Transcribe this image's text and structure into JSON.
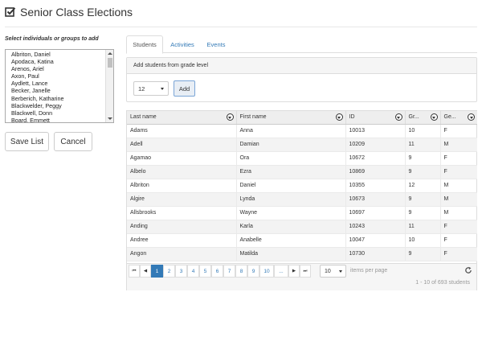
{
  "header": {
    "title": "Senior Class Elections",
    "icon": "checkbox-icon"
  },
  "left": {
    "label": "Select individuals or groups to add",
    "names": [
      "Albriton, Daniel",
      "Apodaca, Katina",
      "Arenos, Ariel",
      "Axon, Paul",
      "Aydlett, Lance",
      "Becker, Janelle",
      "Berberich, Katharine",
      "Blackwelder, Peggy",
      "Blackwell, Donn",
      "Board, Emmett"
    ],
    "save_label": "Save List",
    "cancel_label": "Cancel"
  },
  "tabs": [
    {
      "label": "Students"
    },
    {
      "label": "Activities"
    },
    {
      "label": "Events"
    }
  ],
  "grade_panel": {
    "header": "Add students from grade level",
    "selected_grade": "12",
    "add_label": "Add"
  },
  "grid": {
    "columns": [
      "Last name",
      "First name",
      "ID",
      "Gr...",
      "Ge..."
    ],
    "rows": [
      [
        "Adams",
        "Anna",
        "10013",
        "10",
        "F"
      ],
      [
        "Adell",
        "Damian",
        "10209",
        "11",
        "M"
      ],
      [
        "Agamao",
        "Ora",
        "10672",
        "9",
        "F"
      ],
      [
        "Albelo",
        "Ezra",
        "10869",
        "9",
        "F"
      ],
      [
        "Albriton",
        "Daniel",
        "10355",
        "12",
        "M"
      ],
      [
        "Algire",
        "Lynda",
        "10673",
        "9",
        "M"
      ],
      [
        "Allsbrooks",
        "Wayne",
        "10697",
        "9",
        "M"
      ],
      [
        "Anding",
        "Karla",
        "10243",
        "11",
        "F"
      ],
      [
        "Andree",
        "Anabelle",
        "10047",
        "10",
        "F"
      ],
      [
        "Angon",
        "Matilda",
        "10730",
        "9",
        "F"
      ]
    ]
  },
  "pager": {
    "first": "⏮",
    "prev": "◀",
    "next": "▶",
    "last": "⏭",
    "pages": [
      "1",
      "2",
      "3",
      "4",
      "5",
      "6",
      "7",
      "8",
      "9",
      "10",
      "..."
    ],
    "current_page": "1",
    "per_page": "10",
    "per_page_label": "items per page",
    "summary": "1 - 10 of 693 students"
  },
  "colors": {
    "accent": "#337ab7",
    "header_bg": "#eeeeee"
  }
}
